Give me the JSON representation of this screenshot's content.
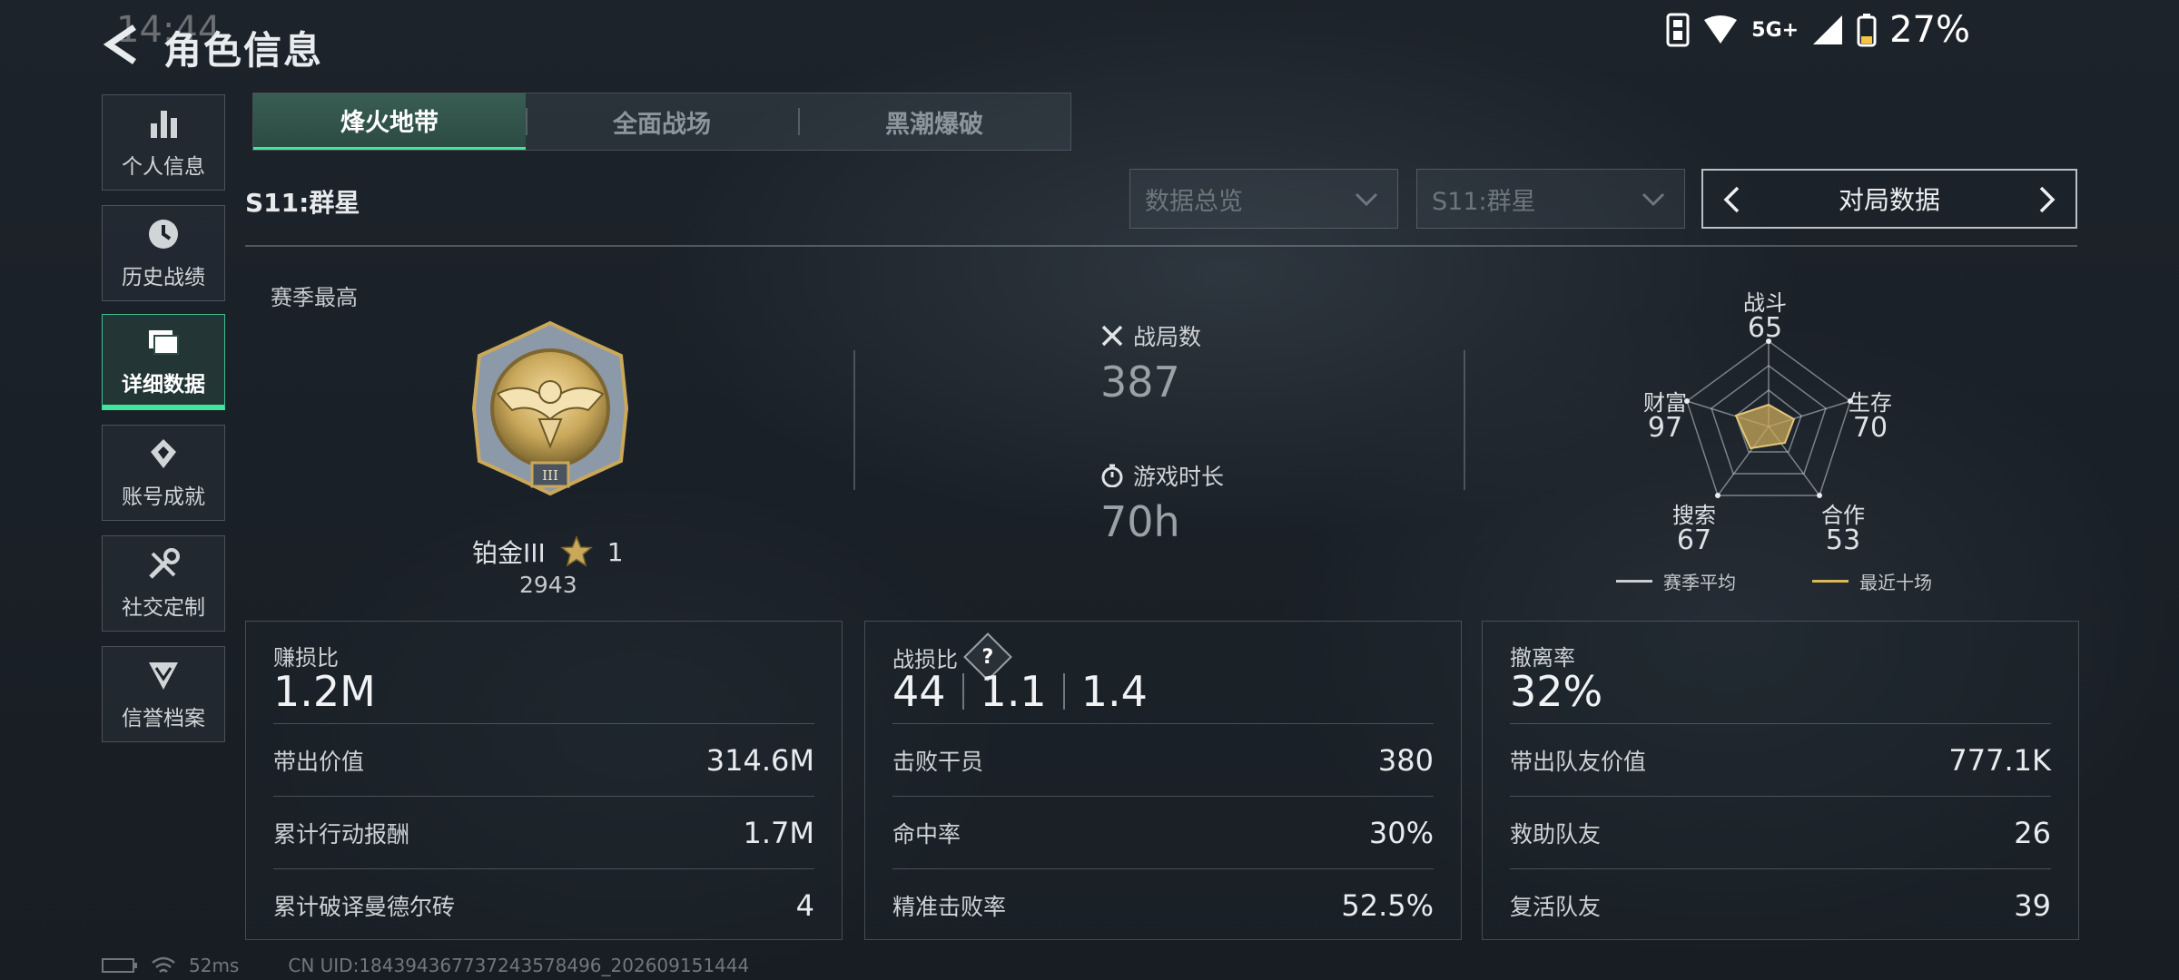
{
  "status": {
    "clock": "14:44",
    "network": "5G+",
    "battery": "27%"
  },
  "header": {
    "title": "角色信息"
  },
  "sidebar": {
    "items": [
      {
        "label": "个人信息"
      },
      {
        "label": "历史战绩"
      },
      {
        "label": "详细数据"
      },
      {
        "label": "账号成就"
      },
      {
        "label": "社交定制"
      },
      {
        "label": "信誉档案"
      }
    ]
  },
  "tabs": [
    {
      "label": "烽火地带"
    },
    {
      "label": "全面战场"
    },
    {
      "label": "黑潮爆破"
    }
  ],
  "season": {
    "title": "S11:群星"
  },
  "filters": {
    "overview": "数据总览",
    "season": "S11:群星",
    "data_type": "对局数据"
  },
  "summary": {
    "season_best_label": "赛季最高",
    "rank_name": "铂金III",
    "rank_stars": "1",
    "rank_score": "2943",
    "matches_label": "战局数",
    "matches_value": "387",
    "playtime_label": "游戏时长",
    "playtime_value": "70h"
  },
  "radar": {
    "axes": [
      {
        "name": "战斗",
        "value": "65"
      },
      {
        "name": "生存",
        "value": "70"
      },
      {
        "name": "合作",
        "value": "53"
      },
      {
        "name": "搜索",
        "value": "67"
      },
      {
        "name": "财富",
        "value": "97"
      }
    ],
    "legend_avg": "赛季平均",
    "legend_recent": "最近十场"
  },
  "cards": {
    "profit": {
      "label": "赚损比",
      "value": "1.2M",
      "rows": [
        {
          "label": "带出价值",
          "value": "314.6M"
        },
        {
          "label": "累计行动报酬",
          "value": "1.7M"
        },
        {
          "label": "累计破译曼德尔砖",
          "value": "4"
        }
      ]
    },
    "kd": {
      "label": "战损比",
      "help": "?",
      "values": [
        "44",
        "1.1",
        "1.4"
      ],
      "rows": [
        {
          "label": "击败干员",
          "value": "380"
        },
        {
          "label": "命中率",
          "value": "30%"
        },
        {
          "label": "精准击败率",
          "value": "52.5%"
        }
      ]
    },
    "extract": {
      "label": "撤离率",
      "value": "32%",
      "rows": [
        {
          "label": "带出队友价值",
          "value": "777.1K"
        },
        {
          "label": "救助队友",
          "value": "26"
        },
        {
          "label": "复活队友",
          "value": "39"
        }
      ]
    }
  },
  "footer": {
    "ping": "52ms",
    "uid": "CN UID:18439436773724357849​6_202609151444"
  },
  "colors": {
    "accent": "#46e3a2",
    "gold": "#c9a85a"
  }
}
